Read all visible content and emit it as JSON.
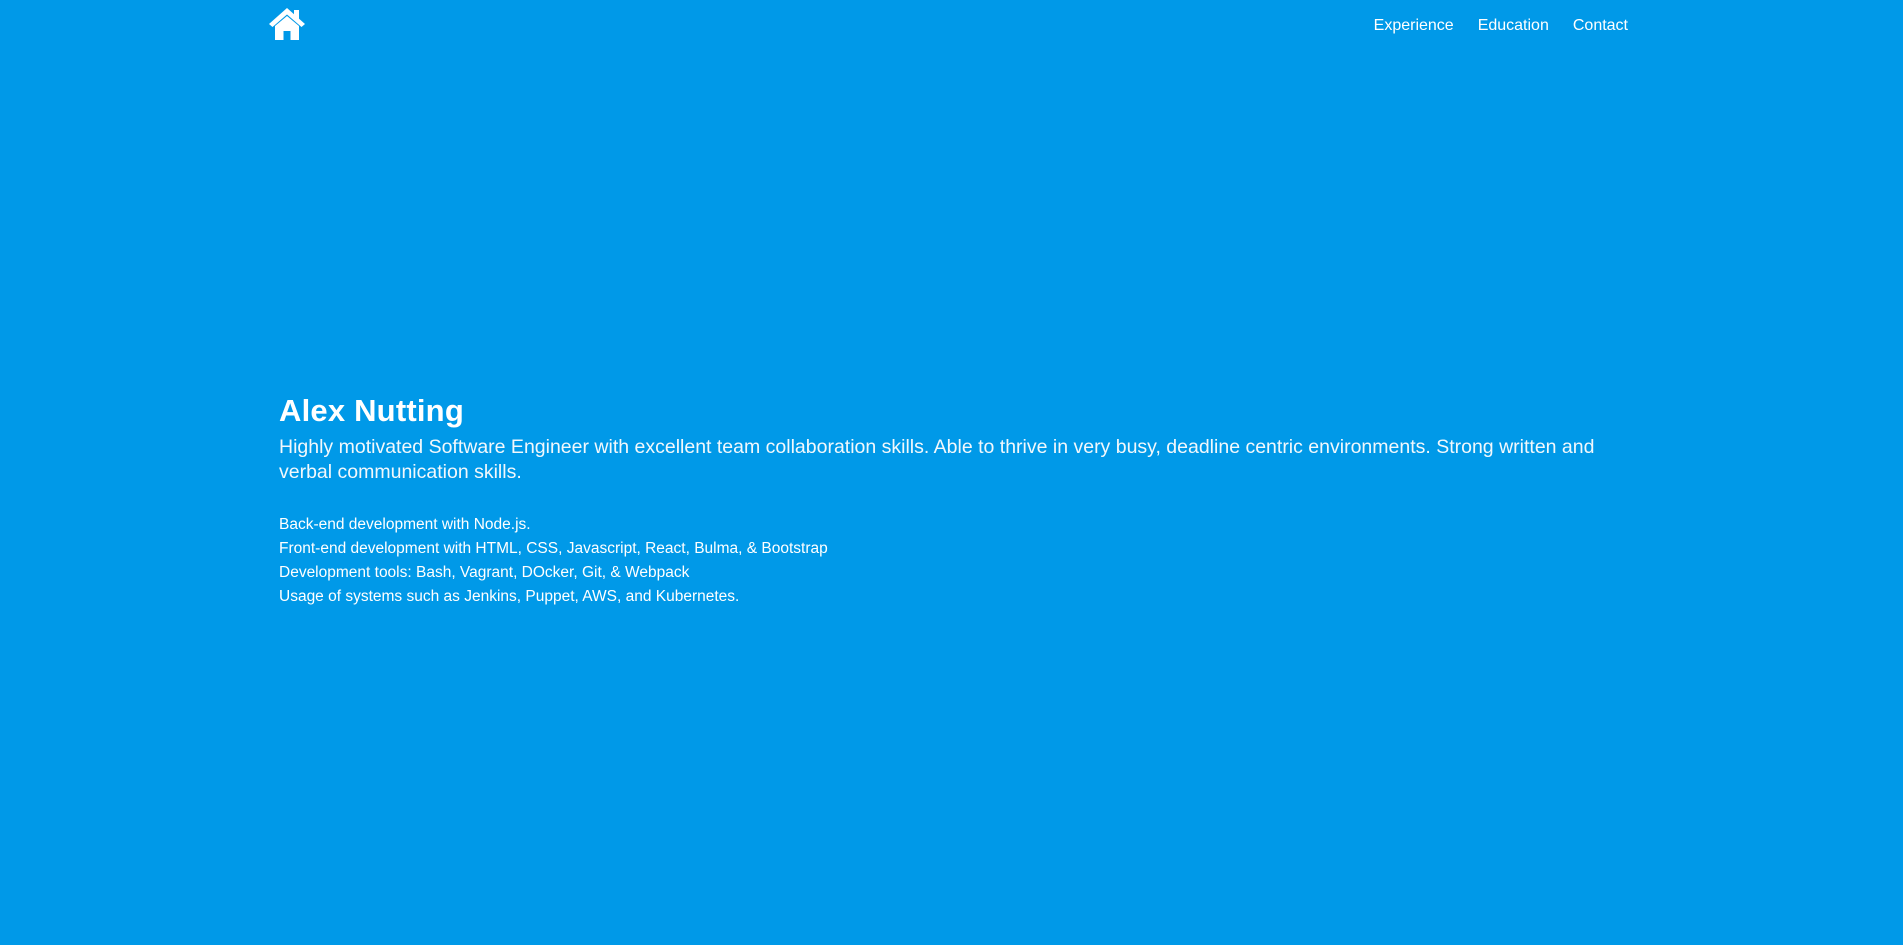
{
  "nav": {
    "home_icon": "home-icon",
    "items": [
      {
        "label": "Experience"
      },
      {
        "label": "Education"
      },
      {
        "label": "Contact"
      }
    ]
  },
  "hero": {
    "title": "Alex Nutting",
    "subtitle": "Highly motivated Software Engineer with excellent team collaboration skills. Able to thrive in very busy, deadline centric environments. Strong written and verbal communication skills.",
    "skills": [
      "Back-end development with Node.js.",
      "Front-end development with HTML, CSS, Javascript, React, Bulma, & Bootstrap",
      "Development tools: Bash, Vagrant, DOcker, Git, & Webpack",
      "Usage of systems such as Jenkins, Puppet, AWS, and Kubernetes."
    ]
  },
  "colors": {
    "background": "#0099e8",
    "text": "#ffffff"
  }
}
